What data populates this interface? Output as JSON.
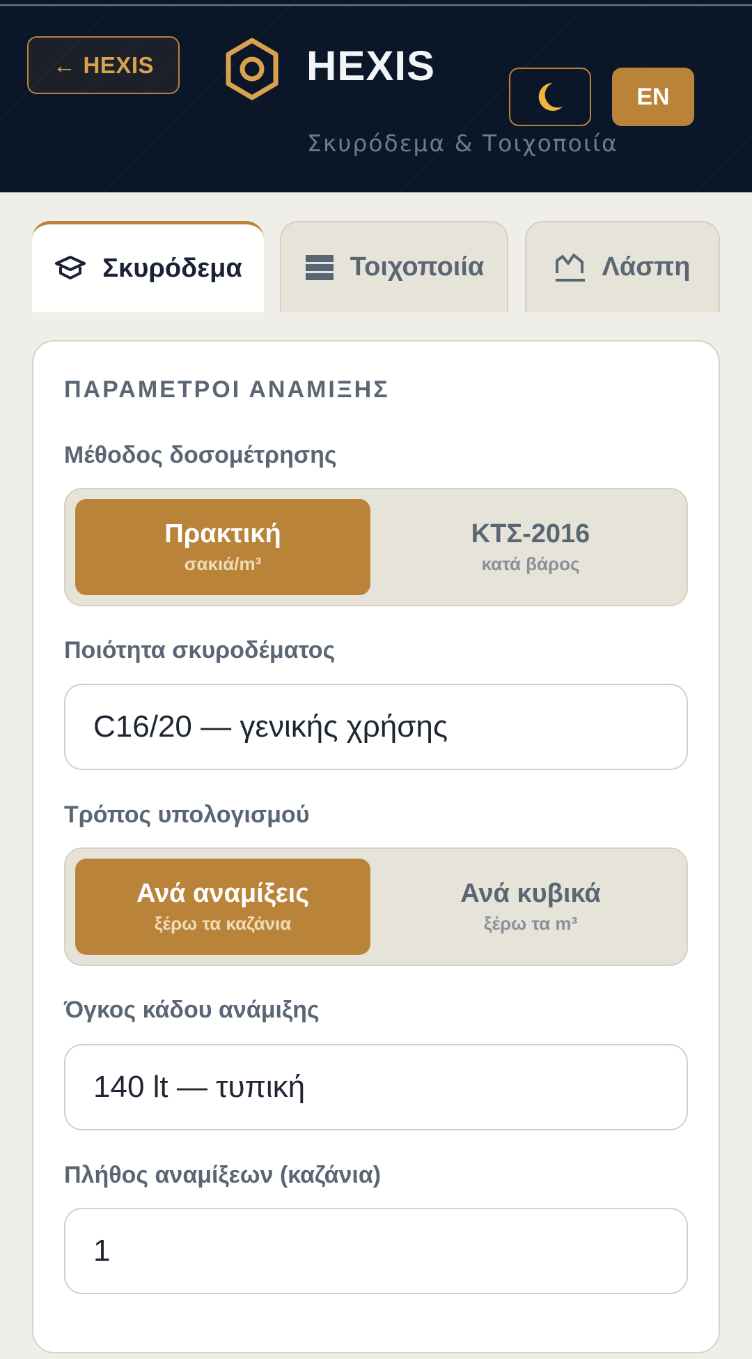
{
  "header": {
    "back_label": "HEXIS",
    "back_arrow": "←",
    "brand_title": "HEXIS",
    "brand_subtitle": "Σκυρόδεμα & Τοιχοποιία",
    "theme_icon": "moon-icon",
    "lang_label": "EN",
    "accent_color": "#b9843a",
    "bg_color": "#0b1628"
  },
  "tabs": [
    {
      "label": "Σκυρόδεμα",
      "icon": "layers-icon",
      "active": true
    },
    {
      "label": "Τοιχοποιία",
      "icon": "bricks-icon",
      "active": false
    },
    {
      "label": "Λάσπη",
      "icon": "mortar-icon",
      "active": false
    }
  ],
  "form": {
    "section_title": "ΠΑΡΑΜΕΤΡΟΙ ΑΝΑΜΙΞΗΣ",
    "dosing": {
      "label": "Μέθοδος δοσομέτρησης",
      "options": [
        {
          "main": "Πρακτική",
          "sub": "σακιά/m³",
          "active": true
        },
        {
          "main": "ΚΤΣ-2016",
          "sub": "κατά βάρος",
          "active": false
        }
      ]
    },
    "quality": {
      "label": "Ποιότητα σκυροδέματος",
      "value": "C16/20 — γενικής χρήσης"
    },
    "calc_mode": {
      "label": "Τρόπος υπολογισμού",
      "options": [
        {
          "main": "Ανά αναμίξεις",
          "sub": "ξέρω τα καζάνια",
          "active": true
        },
        {
          "main": "Ανά κυβικά",
          "sub": "ξέρω τα m³",
          "active": false
        }
      ]
    },
    "drum": {
      "label": "Όγκος κάδου ανάμιξης",
      "value": "140 lt — τυπική"
    },
    "batches": {
      "label": "Πλήθος αναμίξεων (καζάνια)",
      "value": "1"
    }
  }
}
